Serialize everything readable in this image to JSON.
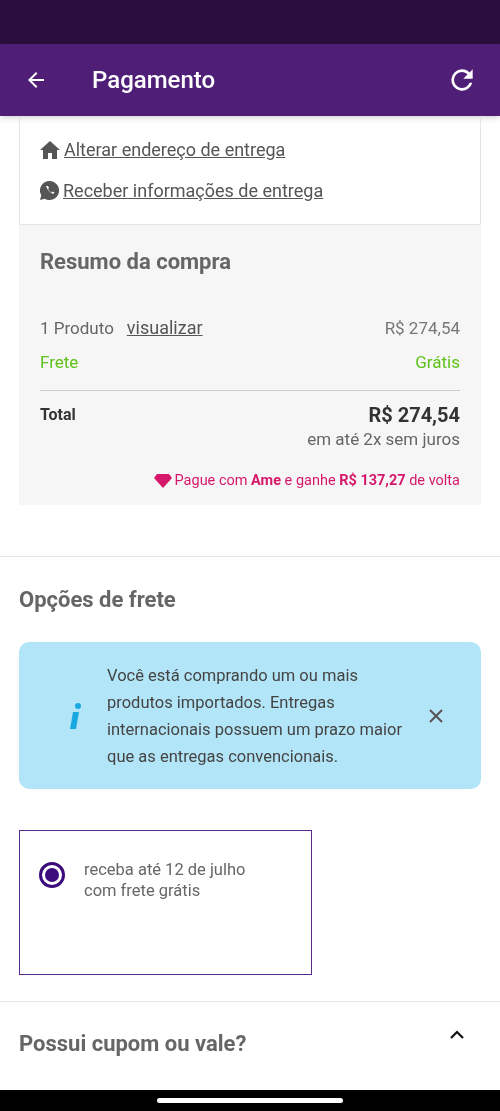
{
  "header": {
    "title": "Pagamento"
  },
  "delivery_links": [
    {
      "kind": "home",
      "label": "Alterar endereço de entrega"
    },
    {
      "kind": "chat",
      "label": "Receber informações de entrega"
    }
  ],
  "summary": {
    "title": "Resumo da compra",
    "product_count": "1 Produto",
    "view_link": "visualizar",
    "product_price": "R$ 274,54",
    "shipping_label": "Frete",
    "shipping_value": "Grátis",
    "total_label": "Total",
    "total_value": "R$ 274,54",
    "installments": "em até 2x sem juros",
    "cashback": "Pague com **Ame** e ganhe **R$ 137,27** de volta"
  },
  "shipping": {
    "title": "Opções de frete",
    "notice": "Você está comprando um ou mais produtos importados. Entregas internacionais possuem um prazo maior que as entregas convencionais.",
    "options": [
      {
        "label": "receba até 12 de julho com frete grátis",
        "selected": true
      }
    ]
  },
  "coupon": {
    "title": "Possui cupom ou vale?",
    "expanded": true
  }
}
